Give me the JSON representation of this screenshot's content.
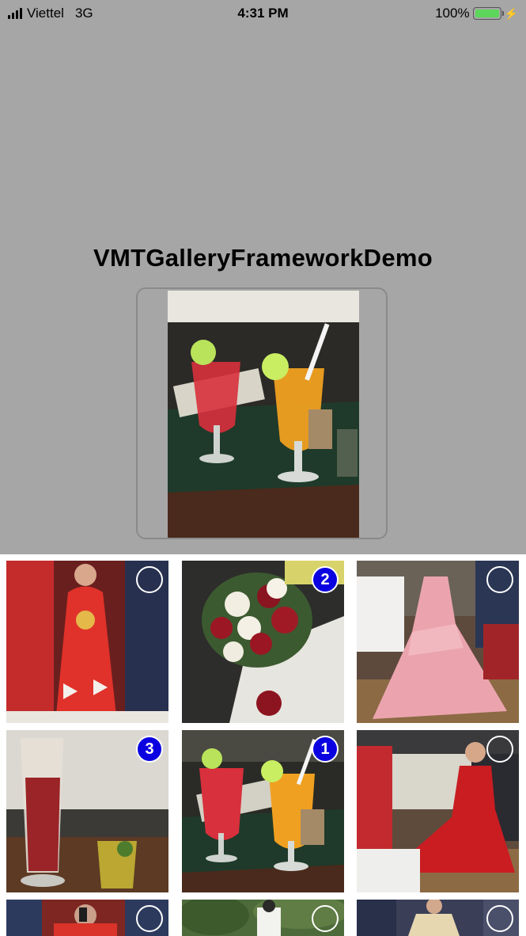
{
  "status_bar": {
    "carrier": "Viettel",
    "network": "3G",
    "time": "4:31 PM",
    "battery_text": "100%",
    "battery_level": 1.0,
    "battery_color": "#5cd75c"
  },
  "app": {
    "title": "VMTGalleryFrameworkDemo"
  },
  "colors": {
    "top_background": "#a6a6a6",
    "selection_badge": "#0b00e0"
  },
  "gallery": {
    "items": [
      {
        "subject": "red-ao-dai-photo",
        "selected": false,
        "order": ""
      },
      {
        "subject": "rose-bouquet-photo",
        "selected": true,
        "order": "2"
      },
      {
        "subject": "pink-gown-photo",
        "selected": false,
        "order": ""
      },
      {
        "subject": "iced-drink-photo",
        "selected": true,
        "order": "3"
      },
      {
        "subject": "juice-glasses-photo",
        "selected": true,
        "order": "1"
      },
      {
        "subject": "red-gown-photo",
        "selected": false,
        "order": ""
      },
      {
        "subject": "red-outfit-photo",
        "selected": false,
        "order": ""
      },
      {
        "subject": "garden-photo",
        "selected": false,
        "order": ""
      },
      {
        "subject": "bridal-dress-photo",
        "selected": false,
        "order": ""
      }
    ]
  }
}
